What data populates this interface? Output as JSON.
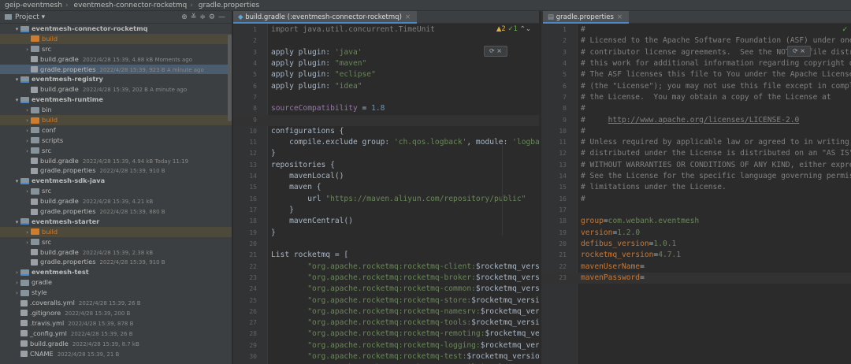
{
  "breadcrumb": [
    "geip-eventmesh",
    "eventmesh-connector-rocketmq",
    "gradle.properties"
  ],
  "project_panel": {
    "title": "Project",
    "tree": [
      {
        "depth": 1,
        "arrow": "▾",
        "icon": "mod",
        "label": "eventmesh-connector-rocketmq",
        "bold": true,
        "meta": ""
      },
      {
        "depth": 2,
        "arrow": "",
        "icon": "excl",
        "label": "build",
        "orange": true,
        "meta": "",
        "excl": true
      },
      {
        "depth": 2,
        "arrow": "›",
        "icon": "fo",
        "label": "src",
        "meta": ""
      },
      {
        "depth": 2,
        "arrow": "",
        "icon": "fi",
        "label": "build.gradle",
        "meta": "2022/4/28 15:39, 4.88 kB Moments ago"
      },
      {
        "depth": 2,
        "arrow": "",
        "icon": "fi",
        "label": "gradle.properties",
        "meta": "2022/4/28 15:39, 923 B A minute ago",
        "sel": true
      },
      {
        "depth": 1,
        "arrow": "▾",
        "icon": "mod",
        "label": "eventmesh-registry",
        "bold": true,
        "meta": ""
      },
      {
        "depth": 2,
        "arrow": "",
        "icon": "fi",
        "label": "build.gradle",
        "meta": "2022/4/28 15:39, 202 B A minute ago"
      },
      {
        "depth": 1,
        "arrow": "▾",
        "icon": "mod",
        "label": "eventmesh-runtime",
        "bold": true,
        "meta": ""
      },
      {
        "depth": 2,
        "arrow": "›",
        "icon": "fo",
        "label": "bin",
        "meta": ""
      },
      {
        "depth": 2,
        "arrow": "›",
        "icon": "excl",
        "label": "build",
        "orange": true,
        "meta": "",
        "excl": true
      },
      {
        "depth": 2,
        "arrow": "›",
        "icon": "fo",
        "label": "conf",
        "meta": ""
      },
      {
        "depth": 2,
        "arrow": "›",
        "icon": "fo",
        "label": "scripts",
        "meta": ""
      },
      {
        "depth": 2,
        "arrow": "›",
        "icon": "fo",
        "label": "src",
        "meta": ""
      },
      {
        "depth": 2,
        "arrow": "",
        "icon": "fi",
        "label": "build.gradle",
        "meta": "2022/4/28 15:39, 4.94 kB Today 11:19"
      },
      {
        "depth": 2,
        "arrow": "",
        "icon": "fi",
        "label": "gradle.properties",
        "meta": "2022/4/28 15:39, 910 B"
      },
      {
        "depth": 1,
        "arrow": "▾",
        "icon": "mod",
        "label": "eventmesh-sdk-java",
        "bold": true,
        "meta": ""
      },
      {
        "depth": 2,
        "arrow": "›",
        "icon": "fo",
        "label": "src",
        "meta": ""
      },
      {
        "depth": 2,
        "arrow": "",
        "icon": "fi",
        "label": "build.gradle",
        "meta": "2022/4/28 15:39, 4.21 kB"
      },
      {
        "depth": 2,
        "arrow": "",
        "icon": "fi",
        "label": "gradle.properties",
        "meta": "2022/4/28 15:39, 880 B"
      },
      {
        "depth": 1,
        "arrow": "▾",
        "icon": "mod",
        "label": "eventmesh-starter",
        "bold": true,
        "meta": ""
      },
      {
        "depth": 2,
        "arrow": "›",
        "icon": "excl",
        "label": "build",
        "orange": true,
        "meta": "",
        "excl": true
      },
      {
        "depth": 2,
        "arrow": "›",
        "icon": "fo",
        "label": "src",
        "meta": ""
      },
      {
        "depth": 2,
        "arrow": "",
        "icon": "fi",
        "label": "build.gradle",
        "meta": "2022/4/28 15:39, 2.38 kB"
      },
      {
        "depth": 2,
        "arrow": "",
        "icon": "fi",
        "label": "gradle.properties",
        "meta": "2022/4/28 15:39, 910 B"
      },
      {
        "depth": 1,
        "arrow": "›",
        "icon": "mod",
        "label": "eventmesh-test",
        "bold": true,
        "meta": ""
      },
      {
        "depth": 1,
        "arrow": "›",
        "icon": "fo",
        "label": "gradle",
        "meta": ""
      },
      {
        "depth": 1,
        "arrow": "›",
        "icon": "fo",
        "label": "style",
        "meta": ""
      },
      {
        "depth": 1,
        "arrow": "",
        "icon": "fi",
        "label": ".coveralls.yml",
        "meta": "2022/4/28 15:39, 26 B"
      },
      {
        "depth": 1,
        "arrow": "",
        "icon": "fi",
        "label": ".gitignore",
        "meta": "2022/4/28 15:39, 200 B"
      },
      {
        "depth": 1,
        "arrow": "",
        "icon": "fi",
        "label": ".travis.yml",
        "meta": "2022/4/28 15:39, 878 B"
      },
      {
        "depth": 1,
        "arrow": "",
        "icon": "fi",
        "label": "_config.yml",
        "meta": "2022/4/28 15:39, 26 B"
      },
      {
        "depth": 1,
        "arrow": "",
        "icon": "fi",
        "label": "build.gradle",
        "meta": "2022/4/28 15:39, 8.7 kB"
      },
      {
        "depth": 1,
        "arrow": "",
        "icon": "fi",
        "label": "CNAME",
        "meta": "2022/4/28 15:39, 21 B"
      }
    ]
  },
  "editor_left": {
    "tab_label": "build.gradle (:eventmesh-connector-rocketmq)",
    "inspection": {
      "warnings": "2",
      "ok": "1"
    },
    "lines": [
      [
        [
          "cmt",
          "import java.util.concurrent.TimeUnit"
        ]
      ],
      [],
      [
        [
          "plain",
          "apply plugin: "
        ],
        [
          "str",
          "'java'"
        ]
      ],
      [
        [
          "plain",
          "apply plugin: "
        ],
        [
          "str",
          "\"maven\""
        ]
      ],
      [
        [
          "plain",
          "apply plugin: "
        ],
        [
          "str",
          "\"eclipse\""
        ]
      ],
      [
        [
          "plain",
          "apply plugin: "
        ],
        [
          "str",
          "\"idea\""
        ]
      ],
      [],
      [
        [
          "prop",
          "sourceCompatibility"
        ],
        [
          "plain",
          " = "
        ],
        [
          "num",
          "1.8"
        ]
      ],
      [],
      [
        [
          "plain",
          "configurations {"
        ]
      ],
      [
        [
          "plain",
          "    compile.exclude group: "
        ],
        [
          "str",
          "'ch.qos.logback'"
        ],
        [
          "plain",
          ", module: "
        ],
        [
          "str",
          "'logba"
        ]
      ],
      [
        [
          "plain",
          "}"
        ]
      ],
      [
        [
          "plain",
          "repositories {"
        ]
      ],
      [
        [
          "plain",
          "    mavenLocal()"
        ]
      ],
      [
        [
          "plain",
          "    maven {"
        ]
      ],
      [
        [
          "plain",
          "        url "
        ],
        [
          "str",
          "\"https://maven.aliyun.com/repository/public\""
        ]
      ],
      [
        [
          "plain",
          "    }"
        ]
      ],
      [
        [
          "plain",
          "    mavenCentral()"
        ]
      ],
      [
        [
          "plain",
          "}"
        ]
      ],
      [],
      [
        [
          "plain",
          "List rocketmq = ["
        ]
      ],
      [
        [
          "str",
          "        \"org.apache.rocketmq:rocketmq-client:"
        ],
        [
          "plain",
          "$rocketmq_vers"
        ]
      ],
      [
        [
          "str",
          "        \"org.apache.rocketmq:rocketmq-broker:"
        ],
        [
          "plain",
          "$rocketmq_vers"
        ]
      ],
      [
        [
          "str",
          "        \"org.apache.rocketmq:rocketmq-common:"
        ],
        [
          "plain",
          "$rocketmq_vers"
        ]
      ],
      [
        [
          "str",
          "        \"org.apache.rocketmq:rocketmq-store:"
        ],
        [
          "plain",
          "$rocketmq_versi"
        ]
      ],
      [
        [
          "str",
          "        \"org.apache.rocketmq:rocketmq-namesrv:"
        ],
        [
          "plain",
          "$rocketmq_ver"
        ]
      ],
      [
        [
          "str",
          "        \"org.apache.rocketmq:rocketmq-tools:"
        ],
        [
          "plain",
          "$rocketmq_versi"
        ]
      ],
      [
        [
          "str",
          "        \"org.apache.rocketmq:rocketmq-remoting:"
        ],
        [
          "plain",
          "$rocketmq_ve"
        ]
      ],
      [
        [
          "str",
          "        \"org.apache.rocketmq:rocketmq-logging:"
        ],
        [
          "plain",
          "$rocketmq_ver"
        ]
      ],
      [
        [
          "str",
          "        \"org.apache.rocketmq:rocketmq-test:"
        ],
        [
          "plain",
          "$rocketmq_versio"
        ]
      ],
      [
        [
          "str",
          "        \"org.apache.rocketmq:rocketmq-srvutil:"
        ],
        [
          "plain",
          "$rocketmq_ver"
        ]
      ]
    ]
  },
  "editor_right": {
    "tab_label": "gradle.properties",
    "lines": [
      [
        [
          "cmt",
          "#"
        ]
      ],
      [
        [
          "cmt",
          "# Licensed to the Apache Software Foundation (ASF) under one"
        ]
      ],
      [
        [
          "cmt",
          "# contributor license agreements.  See the NOTICE file distr"
        ]
      ],
      [
        [
          "cmt",
          "# this work for additional information regarding copyright o"
        ]
      ],
      [
        [
          "cmt",
          "# The ASF licenses this file to You under the Apache License"
        ]
      ],
      [
        [
          "cmt",
          "# (the \"License\"); you may not use this file except in compl"
        ]
      ],
      [
        [
          "cmt",
          "# the License.  You may obtain a copy of the License at"
        ]
      ],
      [
        [
          "cmt",
          "#"
        ]
      ],
      [
        [
          "cmt",
          "#     "
        ],
        [
          "link",
          "http://www.apache.org/licenses/LICENSE-2.0"
        ]
      ],
      [
        [
          "cmt",
          "#"
        ]
      ],
      [
        [
          "cmt",
          "# Unless required by applicable law or agreed to in writing,"
        ]
      ],
      [
        [
          "cmt",
          "# distributed under the License is distributed on an \"AS IS\""
        ]
      ],
      [
        [
          "cmt",
          "# WITHOUT WARRANTIES OR CONDITIONS OF ANY KIND, either expre"
        ]
      ],
      [
        [
          "cmt",
          "# See the License for the specific language governing permis"
        ]
      ],
      [
        [
          "cmt",
          "# limitations under the License."
        ]
      ],
      [
        [
          "cmt",
          "#"
        ]
      ],
      [],
      [
        [
          "key",
          "group"
        ],
        [
          "plain",
          "="
        ],
        [
          "val",
          "com.webank.eventmesh"
        ]
      ],
      [
        [
          "key",
          "version"
        ],
        [
          "plain",
          "="
        ],
        [
          "val",
          "1.2.0"
        ]
      ],
      [
        [
          "key",
          "defibus_version"
        ],
        [
          "plain",
          "="
        ],
        [
          "val",
          "1.0.1"
        ]
      ],
      [
        [
          "key",
          "rocketmq_version"
        ],
        [
          "plain",
          "="
        ],
        [
          "val",
          "4.7.1"
        ]
      ],
      [
        [
          "key",
          "mavenUserName"
        ],
        [
          "plain",
          "="
        ]
      ],
      [
        [
          "key",
          "mavenPassword"
        ],
        [
          "plain",
          "="
        ]
      ]
    ]
  }
}
